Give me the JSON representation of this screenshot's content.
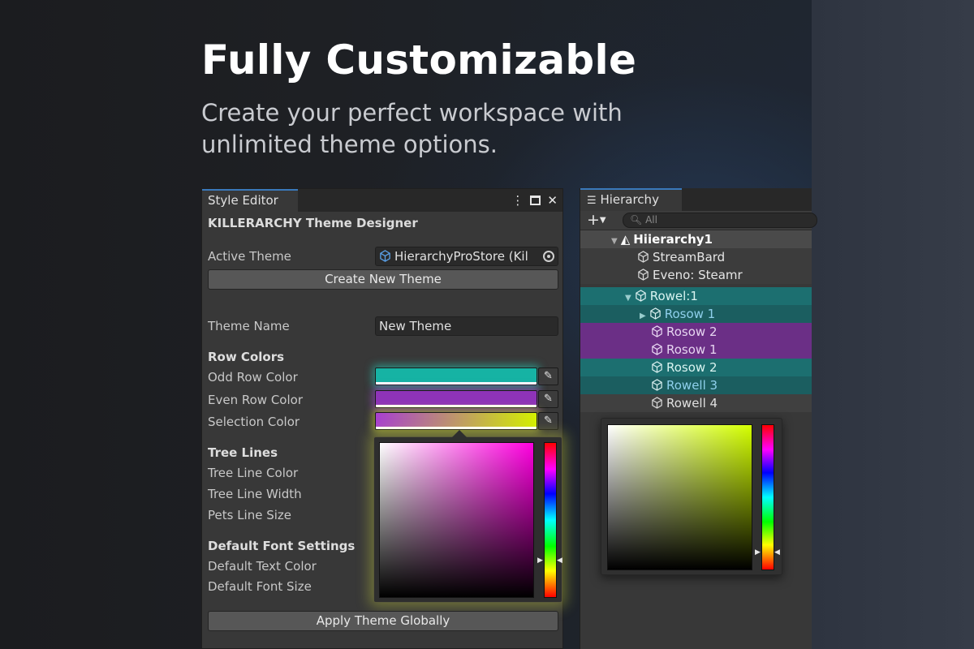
{
  "headline": "Fully Customizable",
  "subline": "Create your perfect workspace with unlimited theme options.",
  "style_editor": {
    "tab_label": "Style Editor",
    "tab_icons": [
      "more-vertical-icon",
      "maximize-icon",
      "close-icon"
    ],
    "designer_title": "KILLERARCHY Theme Designer",
    "active_theme_label": "Active Theme",
    "active_theme_value": "HierarchyProStore (Kil",
    "create_button": "Create New Theme",
    "theme_name_label": "Theme Name",
    "theme_name_value": "New Theme",
    "row_colors_header": "Row Colors",
    "odd_row_label": "Odd Row Color",
    "even_row_label": "Even Row Color",
    "selection_label": "Selection Color",
    "tree_lines_header": "Tree Lines",
    "tree_line_color_label": "Tree Line Color",
    "tree_line_width_label": "Tree Line Width",
    "pets_line_size_label": "Pets Line Size",
    "font_settings_header": "Default Font Settings",
    "text_color_label": "Default Text Color",
    "font_size_label": "Default Font Size",
    "apply_button": "Apply Theme Globally",
    "colors": {
      "odd_row": "#16b3a4",
      "even_row": "#8e33b8",
      "selection_gradient": [
        "#a83fd0",
        "#d4f000"
      ],
      "picker_hue": "#ff00e0"
    }
  },
  "hierarchy": {
    "tab_label": "Hierarchy",
    "search_placeholder": "All",
    "rows": [
      {
        "label": "Hiierarchy1"
      },
      {
        "label": "StreamBard"
      },
      {
        "label": "Eveno: Steamr"
      },
      {
        "label": "Rowel:1"
      },
      {
        "label": "Rosow 1"
      },
      {
        "label": "Rosow 2"
      },
      {
        "label": "Rosow 1"
      },
      {
        "label": "Rosow 2"
      },
      {
        "label": "Rowell 3"
      },
      {
        "label": "Rowell 4"
      }
    ],
    "colors": {
      "teal_row": "#1c6f70",
      "purple_row": "#6b2f86",
      "picker_hue": "#d4ff00"
    }
  }
}
